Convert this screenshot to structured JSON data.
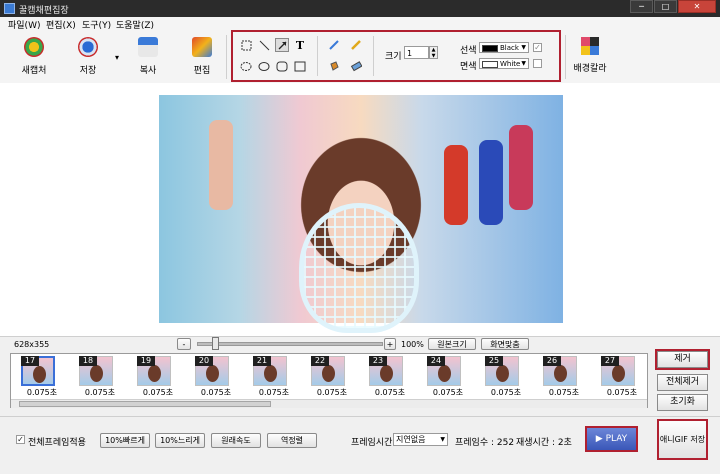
{
  "window": {
    "title": "꿀캠채편집장",
    "controls": {
      "minimize": "─",
      "maximize": "□",
      "close": "✕"
    }
  },
  "menu": {
    "items": [
      {
        "label": "파일(W)"
      },
      {
        "label": "편집(X)"
      },
      {
        "label": "도구(Y)"
      },
      {
        "label": "도움말(Z)"
      }
    ]
  },
  "toolbar": {
    "new_capture": "새캡처",
    "save": "저장",
    "save_dropdown": "▾",
    "copy": "복사",
    "edit": "편집",
    "bg_color": "배경칼라"
  },
  "draw_tools": {
    "text_tool": "T",
    "size_label": "크기",
    "size_value": "1",
    "line_label": "선색",
    "line_color_name": "Black",
    "line_color": "#000000",
    "fill_label": "면색",
    "fill_color_name": "White",
    "fill_color": "#ffffff"
  },
  "canvas": {
    "dimensions": "628x355"
  },
  "frame_controls": {
    "minus": "-",
    "plus": "+",
    "zoom": "100%",
    "original_size": "원본크기",
    "fit_screen": "화면맞춤"
  },
  "frames": [
    {
      "number": "17",
      "duration": "0.075초",
      "selected": true
    },
    {
      "number": "18",
      "duration": "0.075초",
      "selected": false
    },
    {
      "number": "19",
      "duration": "0.075초",
      "selected": false
    },
    {
      "number": "20",
      "duration": "0.075초",
      "selected": false
    },
    {
      "number": "21",
      "duration": "0.075초",
      "selected": false
    },
    {
      "number": "22",
      "duration": "0.075초",
      "selected": false
    },
    {
      "number": "23",
      "duration": "0.075초",
      "selected": false
    },
    {
      "number": "24",
      "duration": "0.075초",
      "selected": false
    },
    {
      "number": "25",
      "duration": "0.075초",
      "selected": false
    },
    {
      "number": "26",
      "duration": "0.075초",
      "selected": false
    },
    {
      "number": "27",
      "duration": "0.075초",
      "selected": false
    }
  ],
  "side_buttons": {
    "remove": "제거",
    "remove_all": "전체제거",
    "reset": "초기화"
  },
  "bottom": {
    "apply_all_label": "전체프레임적용",
    "faster": "10%빠르게",
    "slower": "10%느리게",
    "original_speed": "원래속도",
    "reverse": "역정렬",
    "frame_time_label": "프레임시간",
    "frame_time_value": "지연없음",
    "frame_count": "프레임수 : 252",
    "play_time": "재생시간 : 2초",
    "play": "▶ PLAY",
    "save_gif": "애니GIF 저장"
  },
  "colors": {
    "highlight": "#b02030",
    "selection": "#3a6fd8",
    "play": "#3a57b8"
  }
}
